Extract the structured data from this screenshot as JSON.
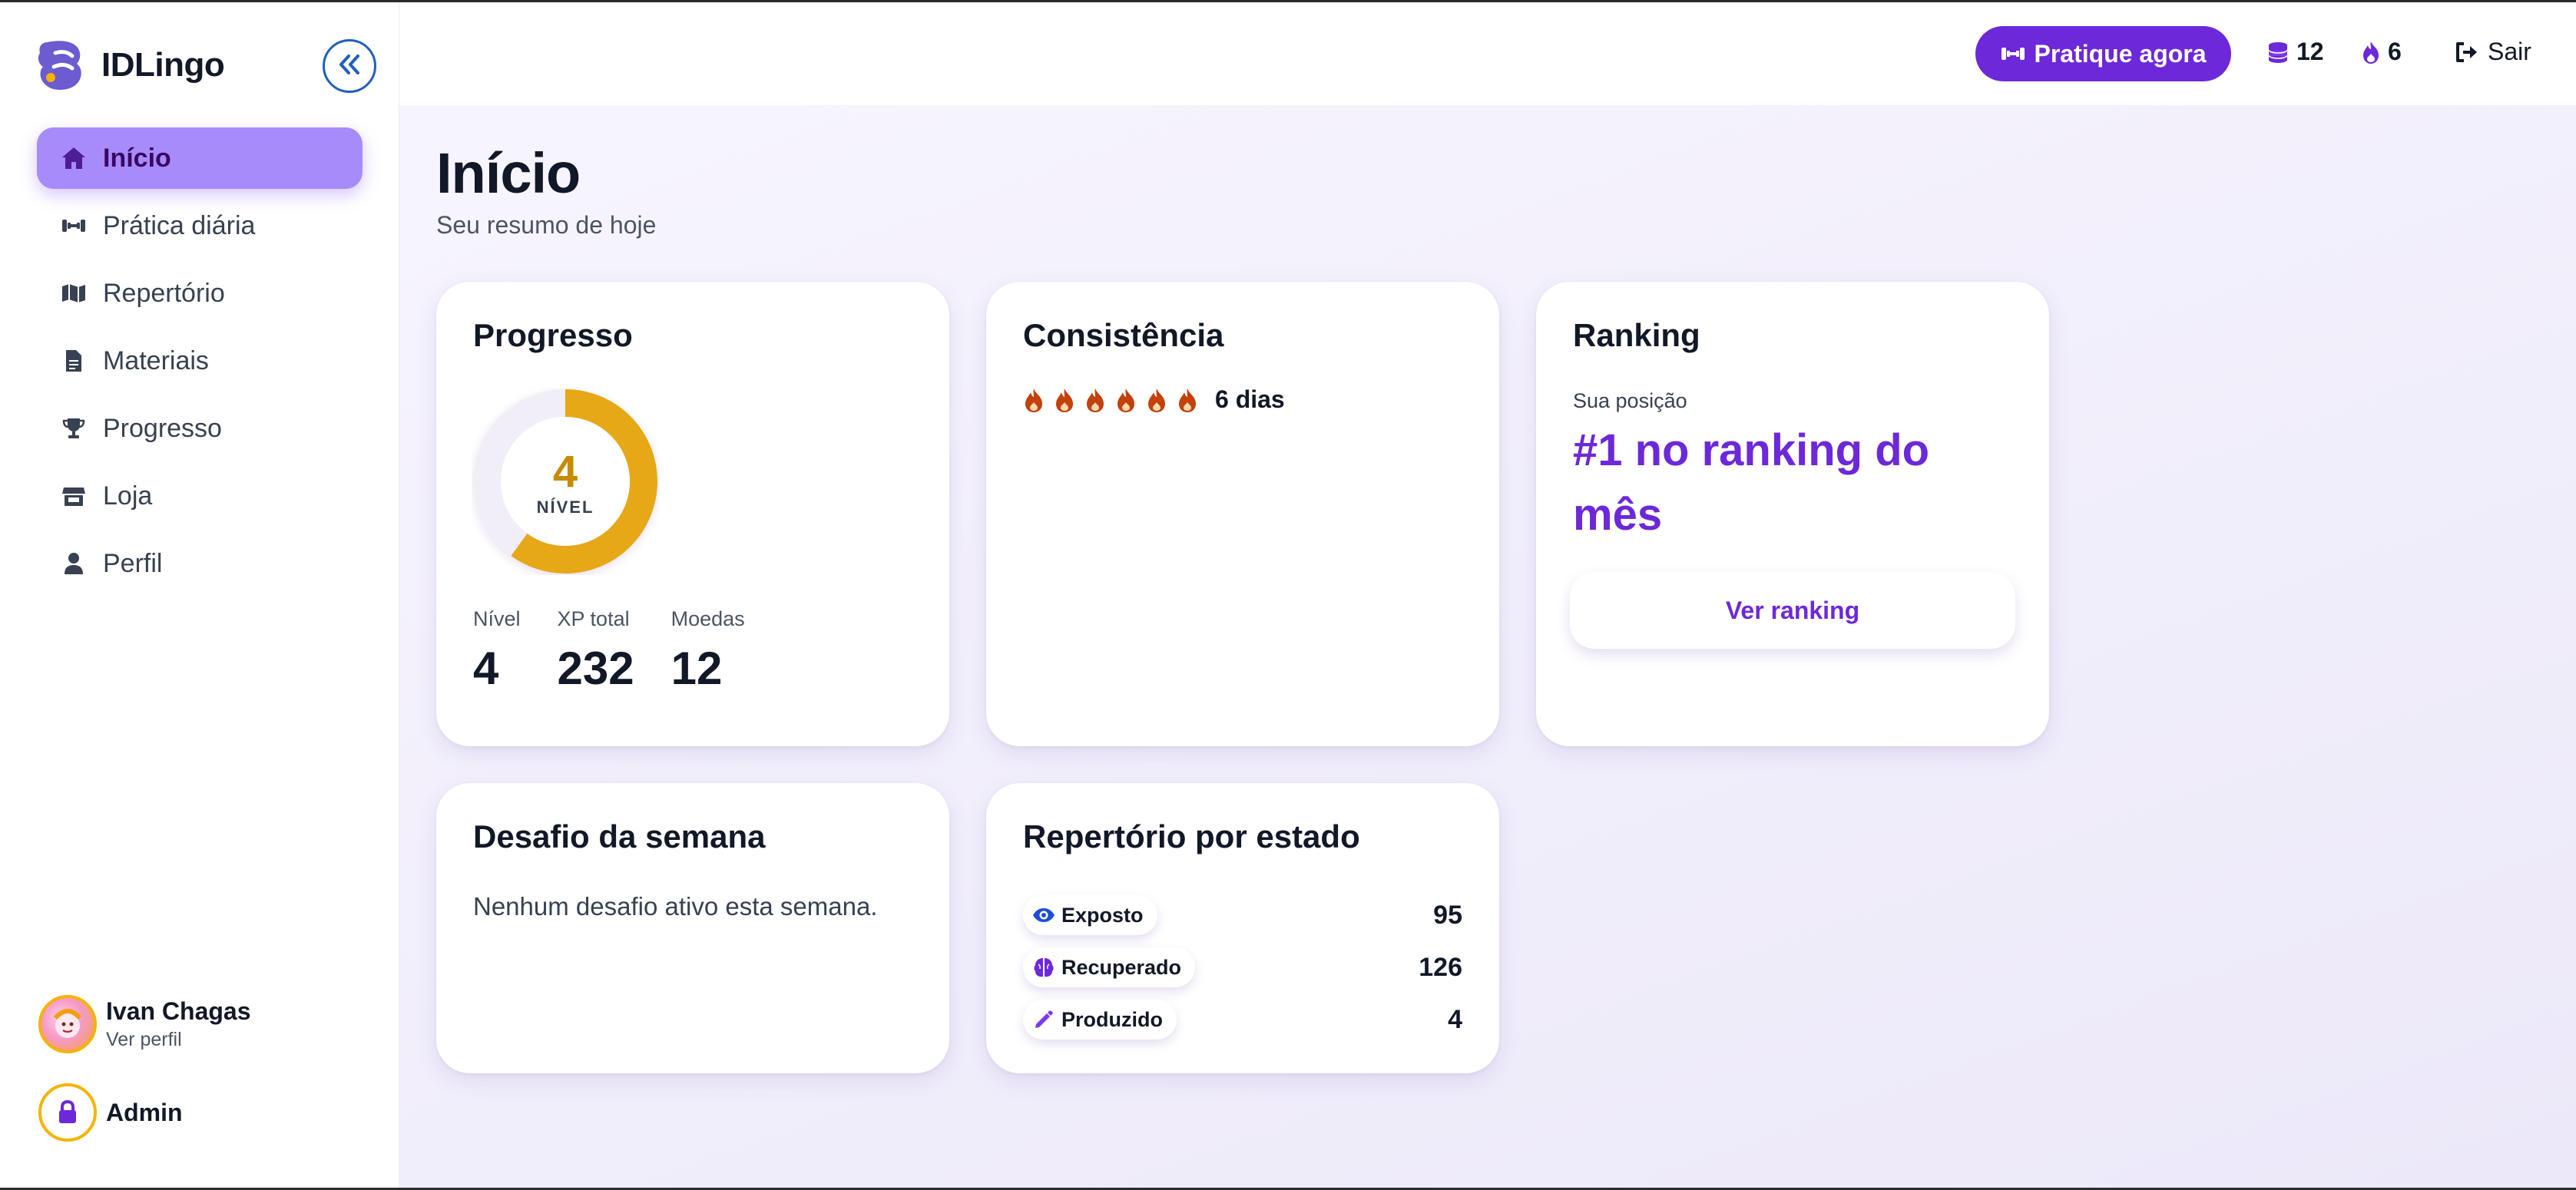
{
  "app": {
    "name": "IDLingo"
  },
  "sidebar": {
    "items": [
      {
        "label": "Início",
        "active": true,
        "icon": "home-icon"
      },
      {
        "label": "Prática diária",
        "active": false,
        "icon": "dumbbell-icon"
      },
      {
        "label": "Repertório",
        "active": false,
        "icon": "map-icon"
      },
      {
        "label": "Materiais",
        "active": false,
        "icon": "document-icon"
      },
      {
        "label": "Progresso",
        "active": false,
        "icon": "trophy-icon"
      },
      {
        "label": "Loja",
        "active": false,
        "icon": "store-icon"
      },
      {
        "label": "Perfil",
        "active": false,
        "icon": "user-icon"
      }
    ],
    "user": {
      "name": "Ivan Chagas",
      "link": "Ver perfil"
    },
    "admin": {
      "label": "Admin"
    }
  },
  "topbar": {
    "cta_label": "Pratique agora",
    "coins": "12",
    "streak": "6",
    "logout_label": "Sair"
  },
  "page": {
    "title": "Início",
    "subtitle": "Seu resumo de hoje"
  },
  "progress_card": {
    "title": "Progresso",
    "level_center": "4",
    "level_center_label": "NÍVEL",
    "level_fill": 0.6,
    "stats": [
      {
        "label": "Nível",
        "value": "4"
      },
      {
        "label": "XP total",
        "value": "232"
      },
      {
        "label": "Moedas",
        "value": "12"
      }
    ]
  },
  "consistency_card": {
    "title": "Consistência",
    "flames": 6,
    "days_text": "6 dias"
  },
  "ranking_card": {
    "title": "Ranking",
    "sub": "Sua posição",
    "position_text": "#1 no ranking do mês",
    "button_label": "Ver ranking"
  },
  "challenge_card": {
    "title": "Desafio da semana",
    "text": "Nenhum desafio ativo esta semana."
  },
  "repertoire_card": {
    "title": "Repertório por estado",
    "rows": [
      {
        "label": "Exposto",
        "value": "95",
        "icon": "eye-icon"
      },
      {
        "label": "Recuperado",
        "value": "126",
        "icon": "brain-icon"
      },
      {
        "label": "Produzido",
        "value": "4",
        "icon": "pencil-icon"
      }
    ]
  },
  "colors": {
    "accent": "#6d28d9",
    "nav_active": "#a78bfa",
    "level_ring": "#e6a817",
    "flame": "#c2410c"
  }
}
